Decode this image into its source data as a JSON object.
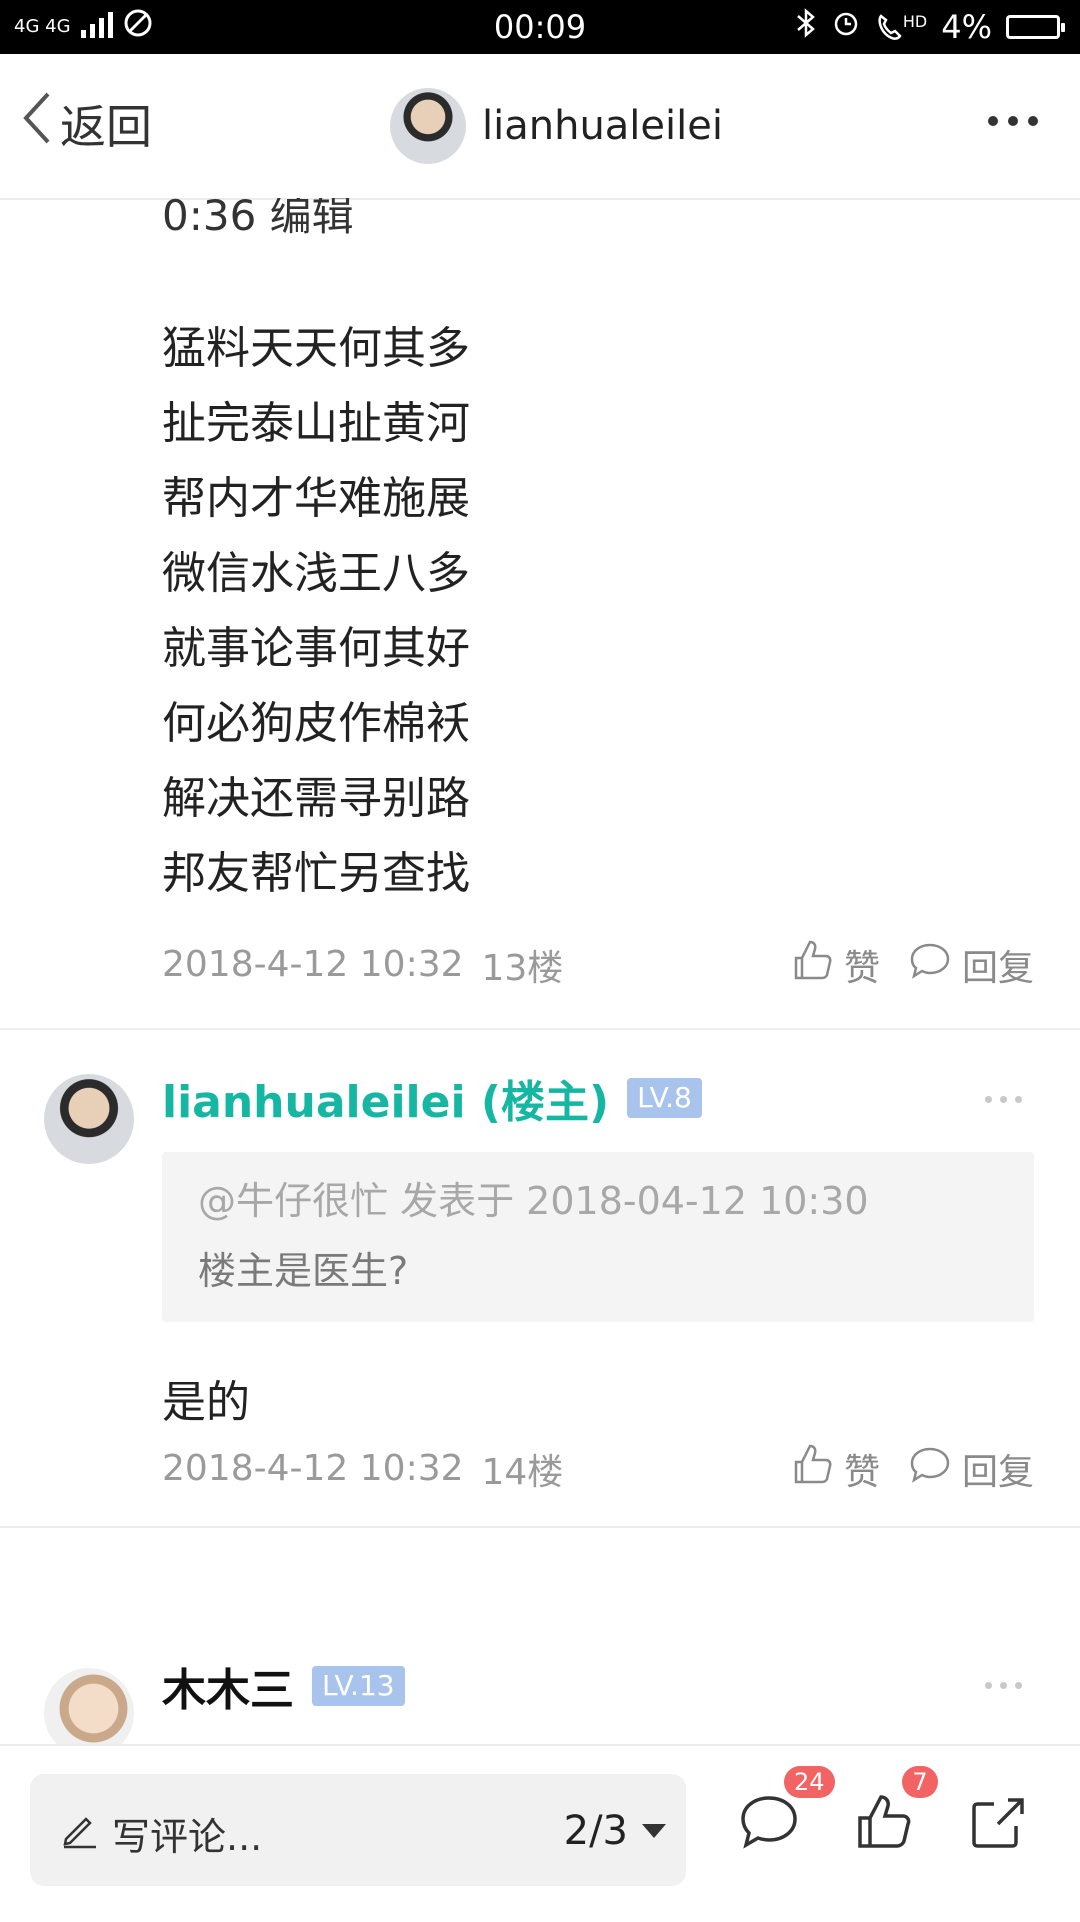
{
  "status_bar": {
    "network": "4G 4G",
    "time": "00:09",
    "hd": "HD",
    "battery": "4%"
  },
  "nav": {
    "back_label": "返回",
    "username": "lianhualeilei"
  },
  "post13": {
    "partial_text": "0:36 编辑",
    "lines": [
      "猛料天天何其多",
      "扯完泰山扯黄河",
      "帮内才华难施展",
      "微信水浅王八多",
      "就事论事何其好",
      "何必狗皮作棉袄",
      "解决还需寻别路",
      "邦友帮忙另查找"
    ],
    "time": "2018-4-12 10:32",
    "floor": "13楼",
    "like_label": "赞",
    "reply_label": "回复"
  },
  "post14": {
    "author": "lianhualeilei (楼主)",
    "level": "LV.8",
    "quote_meta": "@牛仔很忙 发表于 2018-04-12 10:30",
    "quote_text": "楼主是医生?",
    "text": "是的",
    "time": "2018-4-12 10:32",
    "floor": "14楼",
    "like_label": "赞",
    "reply_label": "回复"
  },
  "post15": {
    "author": "木木三",
    "level": "LV.13"
  },
  "bottom_bar": {
    "comment_placeholder": "写评论...",
    "page": "2/3",
    "comments_badge": "24",
    "likes_badge": "7"
  },
  "colors": {
    "author_op": "#16b7a2",
    "level_badge": "#a8c4ec",
    "badge_red": "#f26464"
  }
}
